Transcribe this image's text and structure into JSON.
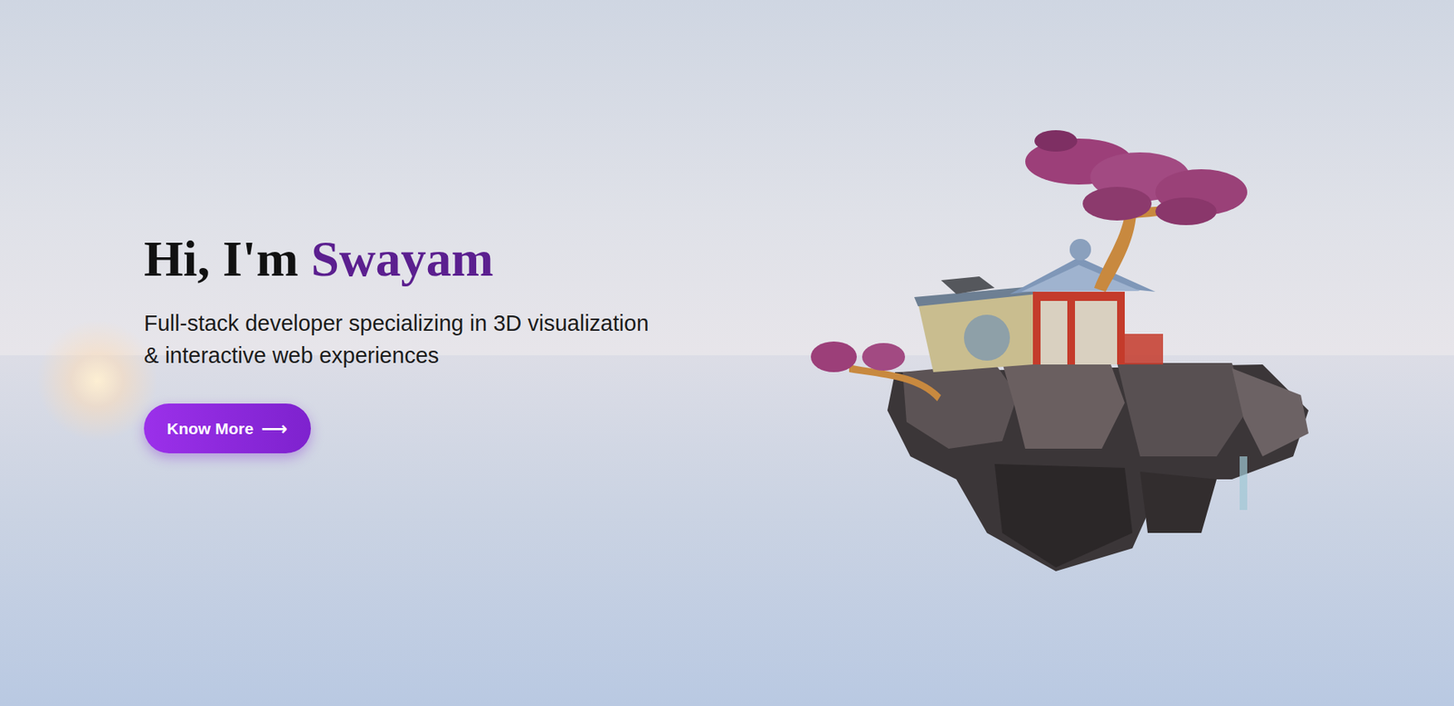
{
  "hero": {
    "greeting": "Hi, I'm ",
    "name": "Swayam",
    "subtitle_lines": [
      "Full-stack developer specializing in 3D visualization",
      "& interactive web experiences"
    ],
    "button": {
      "label": "Know More",
      "icon": "⟶"
    }
  }
}
